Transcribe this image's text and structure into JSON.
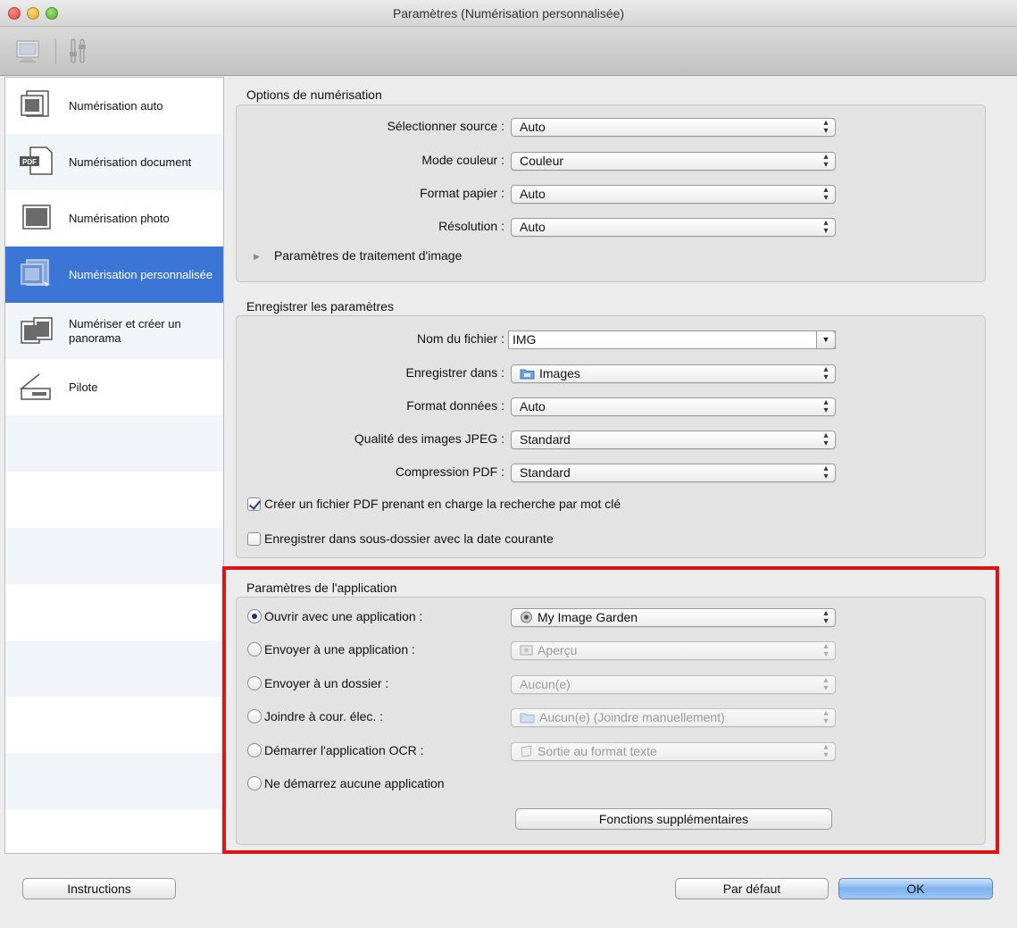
{
  "window": {
    "title": "Paramètres (Numérisation personnalisée)"
  },
  "toolbar": {
    "icons": [
      "scan-settings-icon",
      "general-settings-icon"
    ]
  },
  "sidebar": {
    "items": [
      {
        "label": "Numérisation auto",
        "icon": "auto-scan-icon",
        "selected": false
      },
      {
        "label": "Numérisation document",
        "icon": "pdf-document-icon",
        "selected": false
      },
      {
        "label": "Numérisation photo",
        "icon": "photo-icon",
        "selected": false
      },
      {
        "label": "Numérisation personnalisée",
        "icon": "custom-scan-icon",
        "selected": true
      },
      {
        "label": "Numériser et créer un panorama",
        "icon": "panorama-icon",
        "selected": false
      },
      {
        "label": "Pilote",
        "icon": "driver-icon",
        "selected": false
      }
    ]
  },
  "scan_options": {
    "title": "Options de numérisation",
    "source": {
      "label": "Sélectionner source :",
      "value": "Auto"
    },
    "color_mode": {
      "label": "Mode couleur :",
      "value": "Couleur"
    },
    "paper_size": {
      "label": "Format papier :",
      "value": "Auto"
    },
    "resolution": {
      "label": "Résolution :",
      "value": "Auto"
    },
    "image_processing": "Paramètres de traitement d'image"
  },
  "save_settings": {
    "title": "Enregistrer les paramètres",
    "file_name": {
      "label": "Nom du fichier :",
      "value": "IMG"
    },
    "save_in": {
      "label": "Enregistrer dans :",
      "value": "Images"
    },
    "data_format": {
      "label": "Format données :",
      "value": "Auto"
    },
    "jpeg_quality": {
      "label": "Qualité des images JPEG :",
      "value": "Standard"
    },
    "pdf_compression": {
      "label": "Compression PDF :",
      "value": "Standard"
    },
    "keyword_pdf": {
      "label": "Créer un fichier PDF prenant en charge la recherche par mot clé",
      "checked": true
    },
    "date_subfolder": {
      "label": "Enregistrer dans sous-dossier avec la date courante",
      "checked": false
    }
  },
  "app_settings": {
    "title": "Paramètres de l'application",
    "open_with": {
      "label": "Ouvrir avec une application :",
      "value": "My Image Garden",
      "selected": true
    },
    "send_to_app": {
      "label": "Envoyer à une application :",
      "value": "Aperçu",
      "selected": false
    },
    "send_to_folder": {
      "label": "Envoyer à un dossier :",
      "value": "Aucun(e)",
      "selected": false
    },
    "attach_email": {
      "label": "Joindre à cour. élec. :",
      "value": "Aucun(e) (Joindre manuellement)",
      "selected": false
    },
    "start_ocr": {
      "label": "Démarrer l'application OCR :",
      "value": "Sortie au format texte",
      "selected": false
    },
    "no_app": {
      "label": "Ne démarrez aucune application",
      "selected": false
    },
    "more_functions": "Fonctions supplémentaires"
  },
  "footer": {
    "instructions": "Instructions",
    "defaults": "Par défaut",
    "ok": "OK"
  },
  "colors": {
    "selection": "#3b76d6",
    "highlight": "#e01313",
    "primary_button": "#7fb2ee"
  }
}
